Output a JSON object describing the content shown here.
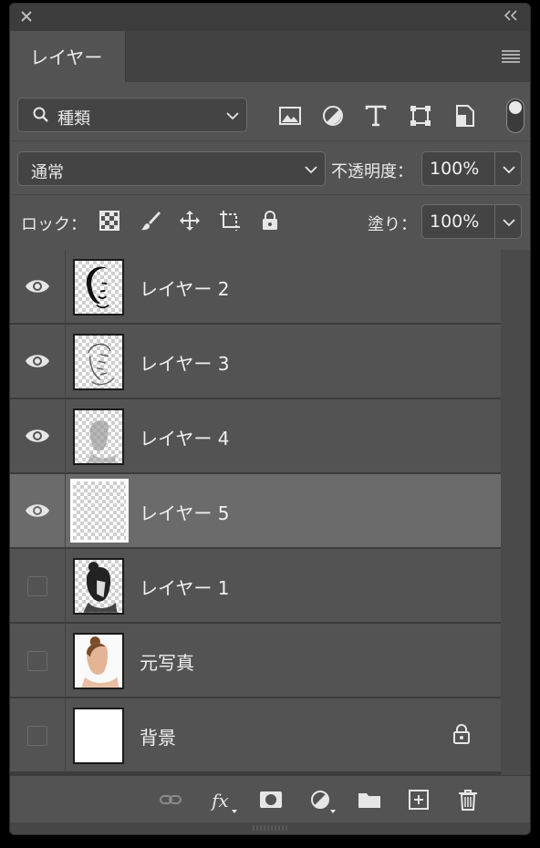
{
  "panel": {
    "tab_label": "レイヤー",
    "filter": {
      "label": "種類"
    },
    "blend_mode": "通常",
    "opacity_label": "不透明度：",
    "opacity_value": "100%",
    "lock_label": "ロック：",
    "fill_label": "塗り：",
    "fill_value": "100%"
  },
  "layers": [
    {
      "name": "レイヤー 2",
      "visible": true,
      "selected": false,
      "thumb": "face-lines-dark"
    },
    {
      "name": "レイヤー 3",
      "visible": true,
      "selected": false,
      "thumb": "face-lines-light"
    },
    {
      "name": "レイヤー 4",
      "visible": true,
      "selected": false,
      "thumb": "face-gray"
    },
    {
      "name": "レイヤー 5",
      "visible": true,
      "selected": true,
      "thumb": "empty-transparent"
    },
    {
      "name": "レイヤー 1",
      "visible": false,
      "selected": false,
      "thumb": "face-posterized"
    },
    {
      "name": "元写真",
      "visible": false,
      "selected": false,
      "thumb": "photo-portrait"
    },
    {
      "name": "背景",
      "visible": false,
      "selected": false,
      "thumb": "white-fill",
      "locked": true
    }
  ],
  "icons": {
    "filters": [
      "image-filter-icon",
      "adjustment-filter-icon",
      "type-filter-icon",
      "shape-filter-icon",
      "smart-object-filter-icon"
    ],
    "locks": [
      "lock-transparent-icon",
      "lock-paint-icon",
      "lock-move-icon",
      "lock-artboard-icon",
      "lock-all-icon"
    ],
    "bottom": [
      "link-layers-icon",
      "fx-icon",
      "layer-mask-icon",
      "adjustment-layer-icon",
      "group-folder-icon",
      "new-layer-icon",
      "trash-icon"
    ]
  },
  "colors": {
    "panel_bg": "#535353",
    "selected_row": "#6b6b6b",
    "title_bar": "#3c3c3c"
  }
}
